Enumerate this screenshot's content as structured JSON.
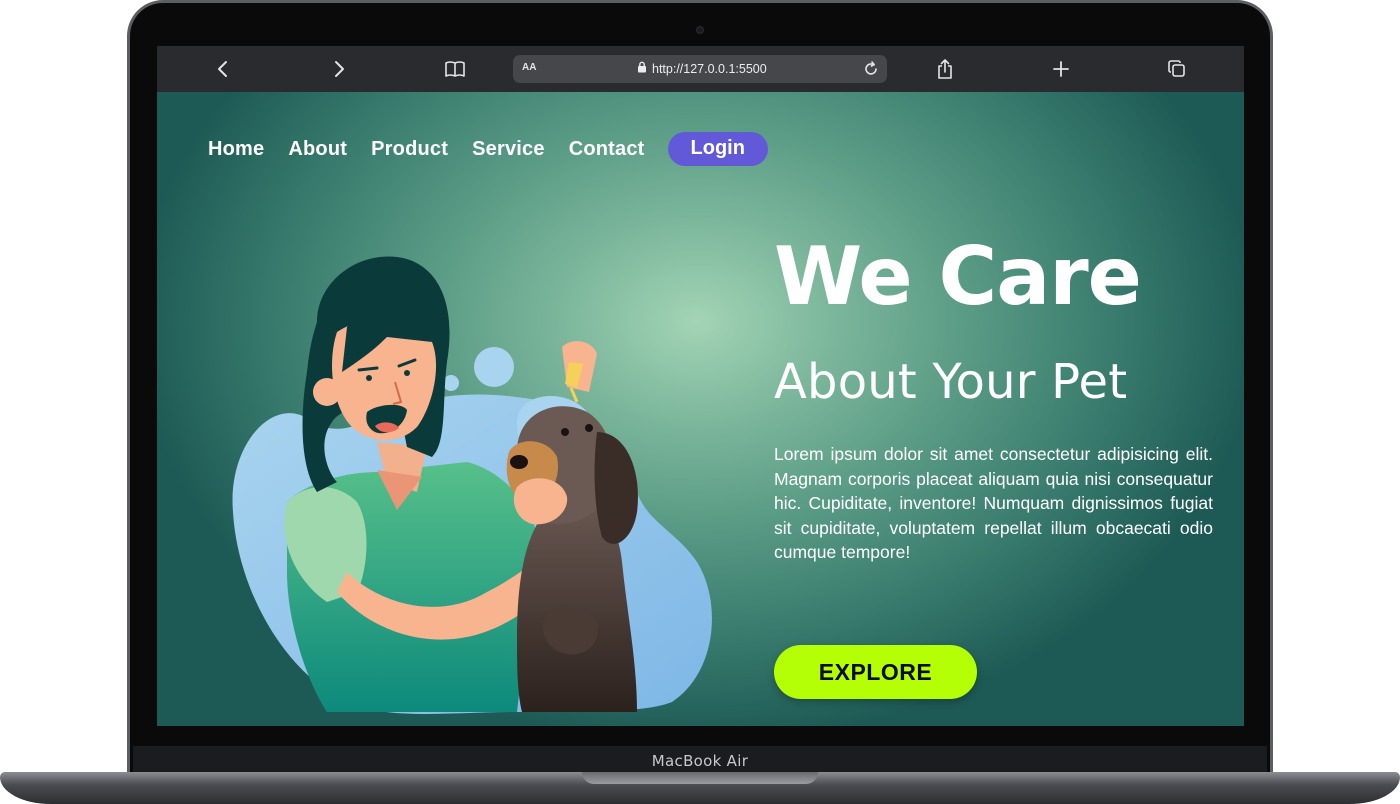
{
  "device": {
    "chin_label": "MacBook Air"
  },
  "browser": {
    "text_size_label": "AA",
    "url": "http://127.0.0.1:5500",
    "icons": [
      "back-icon",
      "forward-icon",
      "book-icon",
      "lock-icon",
      "reload-icon",
      "share-icon",
      "plus-icon",
      "tabs-icon"
    ]
  },
  "nav": {
    "items": [
      "Home",
      "About",
      "Product",
      "Service",
      "Contact"
    ],
    "login_label": "Login"
  },
  "hero": {
    "title": "We Care",
    "subtitle": "About Your Pet",
    "body": "Lorem ipsum dolor sit amet consectetur adipisicing elit. Magnam corporis placeat aliquam quia nisi consequatur hic. Cupiditate, inventore! Numquam dignissimos fugiat sit cupiditate, voluptatem repellat illum obcaecati odio cumque tempore!",
    "cta_label": "EXPLORE"
  },
  "colors": {
    "login_bg": "#6259d9",
    "cta_bg": "#b4ff05",
    "page_center": "#a3d4b5",
    "page_edge": "#1d5a55"
  }
}
